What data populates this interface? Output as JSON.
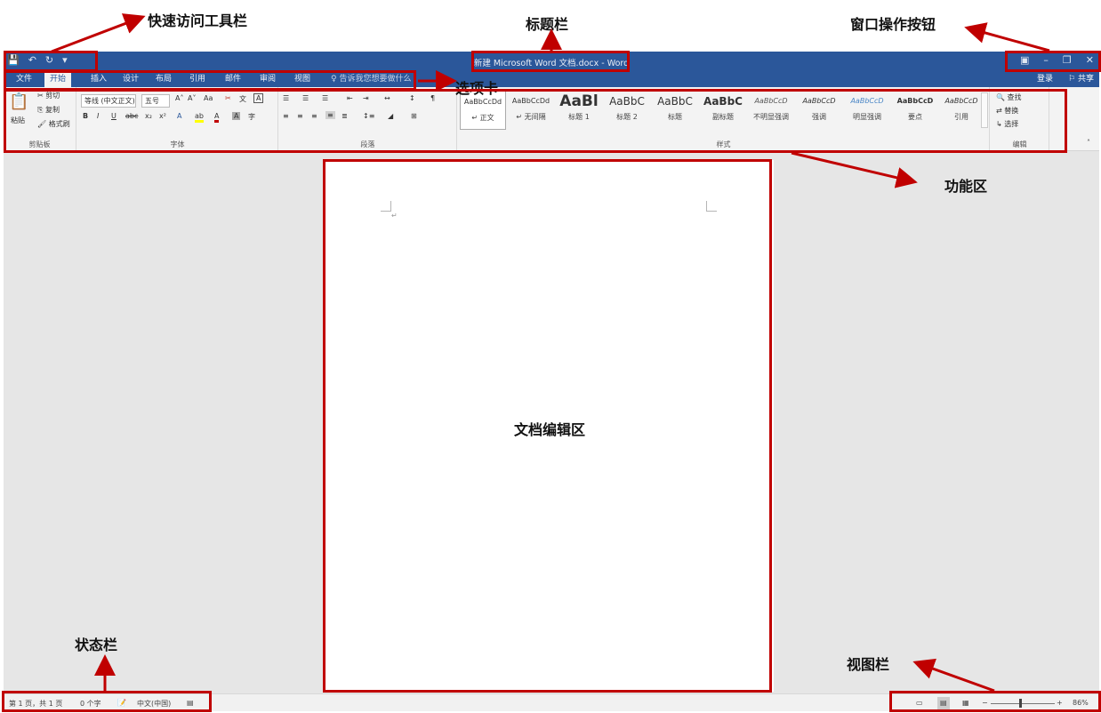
{
  "annotations": {
    "quick_access": "快速访问工具栏",
    "title_bar": "标题栏",
    "window_buttons": "窗口操作按钮",
    "tabs": "选项卡",
    "ribbon": "功能区",
    "doc_area": "文档编辑区",
    "status_bar": "状态栏",
    "view_bar": "视图栏"
  },
  "window": {
    "title": "新建 Microsoft Word 文档.docx - Word",
    "qa_icons": [
      "save-icon",
      "undo-icon",
      "redo-icon",
      "customize-icon"
    ],
    "win_icons": [
      "ribbon-display-icon",
      "minimize-icon",
      "restore-icon",
      "close-icon"
    ]
  },
  "tabs": {
    "items": [
      "文件",
      "开始",
      "插入",
      "设计",
      "布局",
      "引用",
      "邮件",
      "审阅",
      "视图"
    ],
    "active": "开始",
    "tell_me": "告诉我您想要做什么",
    "login": "登录",
    "share": "共享"
  },
  "ribbon": {
    "clipboard": {
      "paste": "粘贴",
      "cut": "剪切",
      "copy": "复制",
      "format_painter": "格式刷",
      "label": "剪贴板"
    },
    "font": {
      "font_name": "等线 (中文正文)",
      "font_size": "五号",
      "label": "字体",
      "case_btn": "Aa"
    },
    "paragraph": {
      "label": "段落"
    },
    "styles": {
      "label": "样式",
      "items": [
        {
          "sample": "AaBbCcDd",
          "name": "↵ 正文"
        },
        {
          "sample": "AaBbCcDd",
          "name": "↵ 无间隔"
        },
        {
          "sample": "AaBl",
          "name": "标题 1"
        },
        {
          "sample": "AaBbC",
          "name": "标题 2"
        },
        {
          "sample": "AaBbC",
          "name": "标题"
        },
        {
          "sample": "AaBbC",
          "name": "副标题"
        },
        {
          "sample": "AaBbCcD",
          "name": "不明显强调"
        },
        {
          "sample": "AaBbCcD",
          "name": "强调"
        },
        {
          "sample": "AaBbCcD",
          "name": "明显强调"
        },
        {
          "sample": "AaBbCcD",
          "name": "要点"
        },
        {
          "sample": "AaBbCcD",
          "name": "引用"
        }
      ]
    },
    "editing": {
      "find": "查找",
      "replace": "替换",
      "select": "选择",
      "label": "编辑"
    }
  },
  "statusbar": {
    "page": "第 1 页，共 1 页",
    "words": "0 个字",
    "language": "中文(中国)",
    "zoom": "86%"
  }
}
